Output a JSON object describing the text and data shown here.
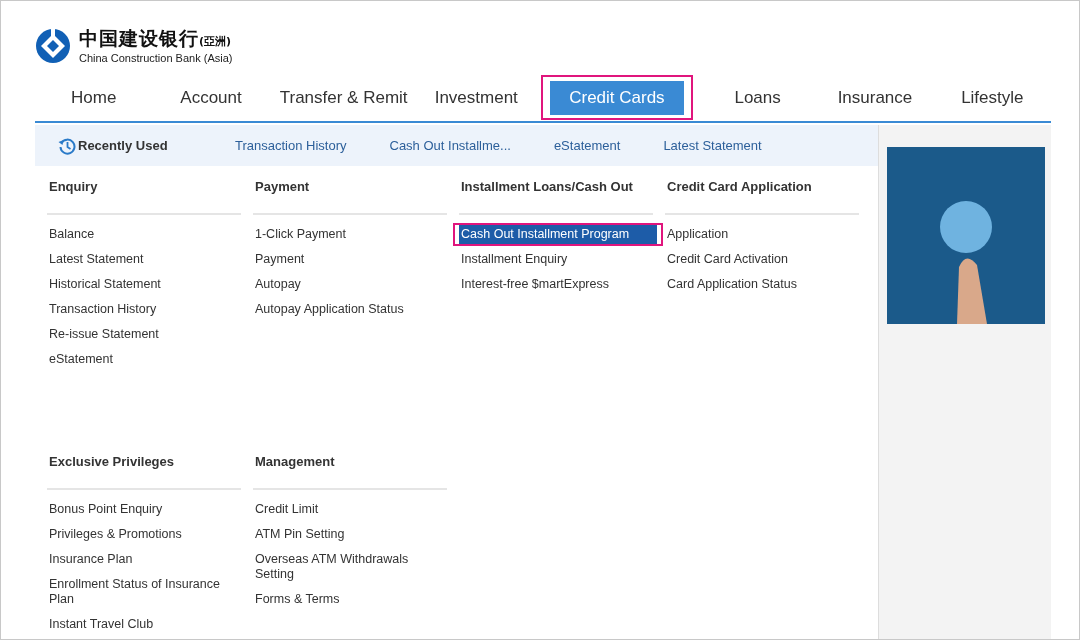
{
  "logo": {
    "chinese_name": "中国建设银行",
    "chinese_suffix": "(亞洲)",
    "english_name": "China Construction Bank (Asia)"
  },
  "tabs": [
    {
      "label": "Home",
      "selected": false,
      "highlighted": false
    },
    {
      "label": "Account",
      "selected": false,
      "highlighted": false
    },
    {
      "label": "Transfer & Remit",
      "selected": false,
      "highlighted": false
    },
    {
      "label": "Investment",
      "selected": false,
      "highlighted": false
    },
    {
      "label": "Credit Cards",
      "selected": true,
      "highlighted": true
    },
    {
      "label": "Loans",
      "selected": false,
      "highlighted": false
    },
    {
      "label": "Insurance",
      "selected": false,
      "highlighted": false
    },
    {
      "label": "Lifestyle",
      "selected": false,
      "highlighted": false
    }
  ],
  "recently_used": {
    "title": "Recently Used",
    "links": [
      "Transaction History",
      "Cash Out Installme...",
      "eStatement",
      "Latest Statement"
    ]
  },
  "menu_rows": [
    {
      "groups": [
        {
          "heading": "Enquiry",
          "items": [
            {
              "label": "Balance",
              "selected": false,
              "highlighted": false
            },
            {
              "label": "Latest Statement",
              "selected": false,
              "highlighted": false
            },
            {
              "label": "Historical Statement",
              "selected": false,
              "highlighted": false
            },
            {
              "label": "Transaction History",
              "selected": false,
              "highlighted": false
            },
            {
              "label": "Re-issue Statement",
              "selected": false,
              "highlighted": false
            },
            {
              "label": "eStatement",
              "selected": false,
              "highlighted": false
            }
          ]
        },
        {
          "heading": "Payment",
          "items": [
            {
              "label": "1-Click Payment",
              "selected": false,
              "highlighted": false
            },
            {
              "label": "Payment",
              "selected": false,
              "highlighted": false
            },
            {
              "label": "Autopay",
              "selected": false,
              "highlighted": false
            },
            {
              "label": "Autopay Application Status",
              "selected": false,
              "highlighted": false
            }
          ]
        },
        {
          "heading": "Installment Loans/Cash Out",
          "items": [
            {
              "label": "Cash Out Installment Program",
              "selected": true,
              "highlighted": true
            },
            {
              "label": "Installment Enquiry",
              "selected": false,
              "highlighted": false
            },
            {
              "label": "Interest-free $martExpress",
              "selected": false,
              "highlighted": false
            }
          ]
        },
        {
          "heading": "Credit Card Application",
          "items": [
            {
              "label": "Application",
              "selected": false,
              "highlighted": false
            },
            {
              "label": "Credit Card Activation",
              "selected": false,
              "highlighted": false
            },
            {
              "label": "Card Application Status",
              "selected": false,
              "highlighted": false
            }
          ]
        }
      ]
    },
    {
      "groups": [
        {
          "heading": "Exclusive Privileges",
          "items": [
            {
              "label": "Bonus Point Enquiry",
              "selected": false,
              "highlighted": false
            },
            {
              "label": "Privileges & Promotions",
              "selected": false,
              "highlighted": false
            },
            {
              "label": "Insurance Plan",
              "selected": false,
              "highlighted": false
            },
            {
              "label": "Enrollment Status of Insurance Plan",
              "selected": false,
              "highlighted": false
            },
            {
              "label": "Instant Travel Club",
              "selected": false,
              "highlighted": false
            }
          ]
        },
        {
          "heading": "Management",
          "items": [
            {
              "label": "Credit Limit",
              "selected": false,
              "highlighted": false
            },
            {
              "label": "ATM Pin Setting",
              "selected": false,
              "highlighted": false
            },
            {
              "label": "Overseas ATM Withdrawals Setting",
              "selected": false,
              "highlighted": false
            },
            {
              "label": "Forms & Terms",
              "selected": false,
              "highlighted": false
            }
          ]
        }
      ]
    }
  ]
}
